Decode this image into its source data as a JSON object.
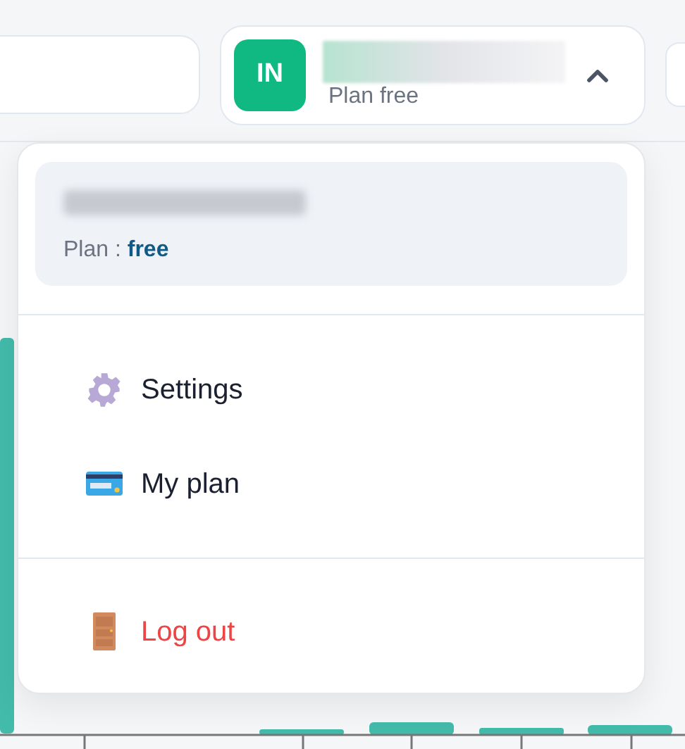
{
  "user_button": {
    "initials": "IN",
    "plan": "Plan free",
    "expanded": true
  },
  "menu": {
    "plan_label": "Plan :",
    "plan_value": "free",
    "sections": [
      [
        {
          "label": "Settings",
          "kind": "settings"
        },
        {
          "label": "My plan",
          "kind": "plan"
        }
      ],
      [
        {
          "label": "Log out",
          "kind": "logout"
        }
      ]
    ]
  }
}
